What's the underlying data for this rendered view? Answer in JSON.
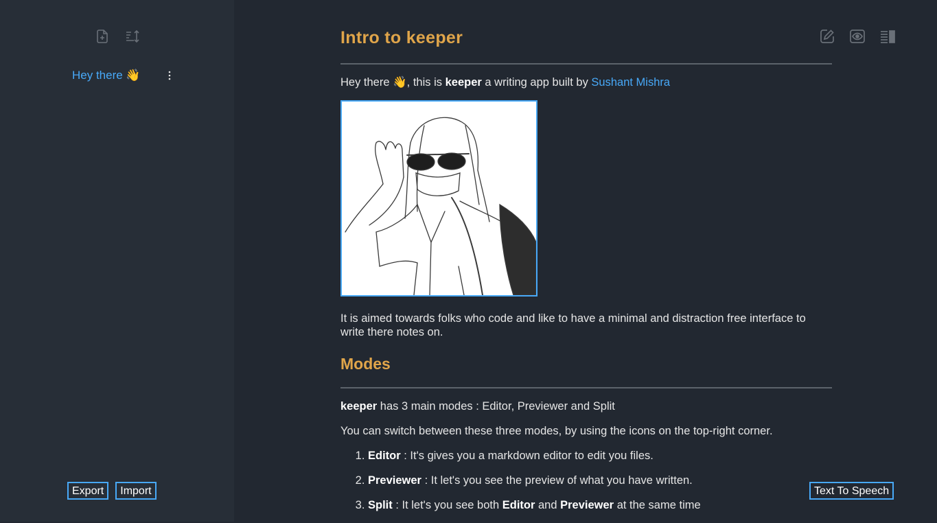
{
  "sidebar": {
    "tools": [
      {
        "name": "new-note-icon"
      },
      {
        "name": "sort-icon"
      }
    ],
    "notes": [
      {
        "title": "Hey there 👋"
      }
    ],
    "export_label": "Export",
    "import_label": "Import"
  },
  "mode_tools": [
    {
      "name": "edit-icon"
    },
    {
      "name": "preview-icon"
    },
    {
      "name": "split-icon"
    }
  ],
  "doc": {
    "title": "Intro to keeper",
    "intro_pre": "Hey there 👋, this is ",
    "intro_bold": "keeper",
    "intro_mid": " a writing app built by ",
    "intro_link": "Sushant Mishra",
    "aim": "It is aimed towards folks who code and like to have a minimal and distraction free interface to write there notes on.",
    "modes_heading": "Modes",
    "modes_line_bold": "keeper",
    "modes_line_rest": " has 3 main modes : Editor, Previewer and Split",
    "switch_line": "You can switch between these three modes, by using the icons on the top-right corner.",
    "list": [
      {
        "bold": "Editor",
        "rest": " : It's gives you a markdown editor to edit you files."
      },
      {
        "bold": "Previewer",
        "rest": " : It let's you see the preview of what you have written."
      },
      {
        "bold": "Split",
        "rest": " : It let's you see both ",
        "bold2": "Editor",
        "mid": " and ",
        "bold3": "Previewer",
        "end": " at the same time"
      }
    ]
  },
  "tts_label": "Text To Speech",
  "colors": {
    "background": "#222831",
    "sidebar": "#272e37",
    "accent": "#48a9f8",
    "heading": "#e0a54a"
  }
}
